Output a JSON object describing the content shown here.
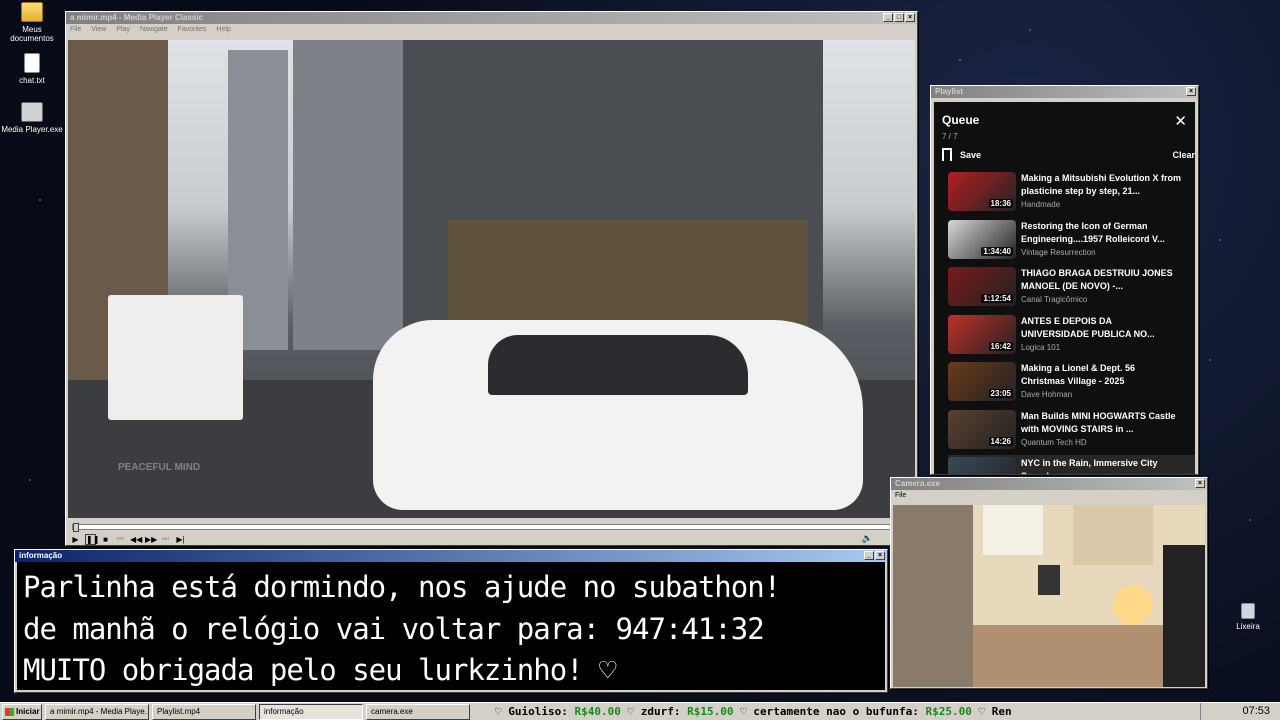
{
  "desktop_icons": [
    {
      "label": "Meus documentos",
      "icon": "folder-icon"
    },
    {
      "label": "chat.txt",
      "icon": "text-file-icon"
    },
    {
      "label": "Media Player.exe",
      "icon": "media-player-icon"
    },
    {
      "label": "Lixeira",
      "icon": "recycle-bin-icon"
    }
  ],
  "media_player": {
    "title": "a mimir.mp4 - Media Player Classic",
    "menu": [
      "File",
      "View",
      "Play",
      "Navigate",
      "Favorites",
      "Help"
    ],
    "watermark": "PEACEFUL MIND",
    "progress": 0.0
  },
  "playlist_window": {
    "title": "Playlist",
    "queue_title": "Queue",
    "count": "7 / 7",
    "save_label": "Save",
    "clear_label": "Clear",
    "items": [
      {
        "title": "Making a Mitsubishi Evolution X from plasticine step by step, 21...",
        "channel": "Handmade",
        "duration": "18:36",
        "color": "#b32020"
      },
      {
        "title": "Restoring the Icon of German Engineering....1957 Rolleicord V...",
        "channel": "Vintage Resurrection",
        "duration": "1:34:40",
        "color": "#d8d8d8"
      },
      {
        "title": "THIAGO BRAGA DESTRUIU JONES MANOEL (DE NOVO) -...",
        "channel": "Canal Tragicômico",
        "duration": "1:12:54",
        "color": "#7a1a1a"
      },
      {
        "title": "ANTES E DEPOIS DA UNIVERSIDADE PUBLICA NO...",
        "channel": "Logica 101",
        "duration": "16:42",
        "color": "#c0302a"
      },
      {
        "title": "Making a Lionel & Dept. 56 Christmas Village - 2025",
        "channel": "Dave Hohman",
        "duration": "23:05",
        "color": "#6a3a1a"
      },
      {
        "title": "Man Builds MINI HOGWARTS Castle with MOVING STAIRS in ...",
        "channel": "Quantum Tech HD",
        "duration": "14:26",
        "color": "#5a4030"
      },
      {
        "title": "NYC in the Rain, Immersive City Soundscape",
        "channel": "",
        "duration": "",
        "color": "#3a4a5a"
      }
    ]
  },
  "camera_window": {
    "title": "Camera.exe",
    "menu": [
      "File"
    ]
  },
  "info_window": {
    "title": "informação",
    "lines": [
      "Parlinha está dormindo, nos ajude no subathon!",
      "de manhã o relógio vai voltar para:  947:41:32",
      "MUITO obrigada pelo seu lurkzinho! ♡"
    ]
  },
  "taskbar": {
    "start_label": "Iniciar",
    "tasks": [
      {
        "label": "a mimir.mp4 - Media Playe...",
        "pressed": false
      },
      {
        "label": "Playlist.mp4",
        "pressed": false
      },
      {
        "label": "informação",
        "pressed": true
      },
      {
        "label": "camera.exe",
        "pressed": false
      }
    ],
    "ticker": [
      {
        "name": "Guioliso:",
        "amount": "R$40.00"
      },
      {
        "name": "zdurf:",
        "amount": "R$15.00"
      },
      {
        "name": "certamente nao o bufunfa:",
        "amount": "R$25.00"
      },
      {
        "name": "Ren",
        "amount": ""
      }
    ],
    "clock": "07:53"
  }
}
